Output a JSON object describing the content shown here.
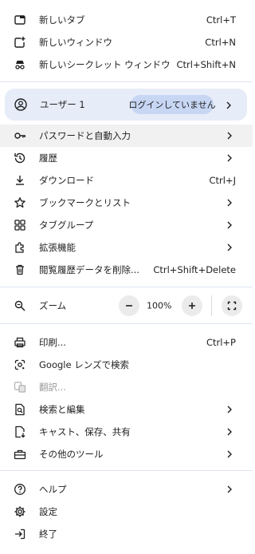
{
  "menu": {
    "new_tab": {
      "label": "新しいタブ",
      "shortcut": "Ctrl+T"
    },
    "new_window": {
      "label": "新しいウィンドウ",
      "shortcut": "Ctrl+N"
    },
    "new_incognito": {
      "label": "新しいシークレット ウィンドウ",
      "shortcut": "Ctrl+Shift+N"
    },
    "profile": {
      "name": "ユーザー 1",
      "status": "ログインしていません"
    },
    "passwords": {
      "label": "パスワードと自動入力"
    },
    "history": {
      "label": "履歴"
    },
    "downloads": {
      "label": "ダウンロード",
      "shortcut": "Ctrl+J"
    },
    "bookmarks": {
      "label": "ブックマークとリスト"
    },
    "tab_groups": {
      "label": "タブグループ"
    },
    "extensions": {
      "label": "拡張機能"
    },
    "clear_data": {
      "label": "閲覧履歴データを削除...",
      "shortcut": "Ctrl+Shift+Delete"
    },
    "zoom": {
      "label": "ズーム",
      "value": "100%",
      "minus": "−",
      "plus": "+"
    },
    "print": {
      "label": "印刷...",
      "shortcut": "Ctrl+P"
    },
    "google_lens": {
      "label": "Google レンズで検索"
    },
    "translate": {
      "label": "翻訳..."
    },
    "find_edit": {
      "label": "検索と編集"
    },
    "cast_save_share": {
      "label": "キャスト、保存、共有"
    },
    "more_tools": {
      "label": "その他のツール"
    },
    "help": {
      "label": "ヘルプ"
    },
    "settings": {
      "label": "設定"
    },
    "exit": {
      "label": "終了"
    }
  },
  "colors": {
    "profile_bg": "#e6ecf8",
    "profile_badge": "#c7d6f3",
    "hover_bg": "#f1f1f1",
    "separator": "#dfe6ee",
    "text": "#1f1f1f",
    "disabled_text": "#9a9a9a"
  }
}
